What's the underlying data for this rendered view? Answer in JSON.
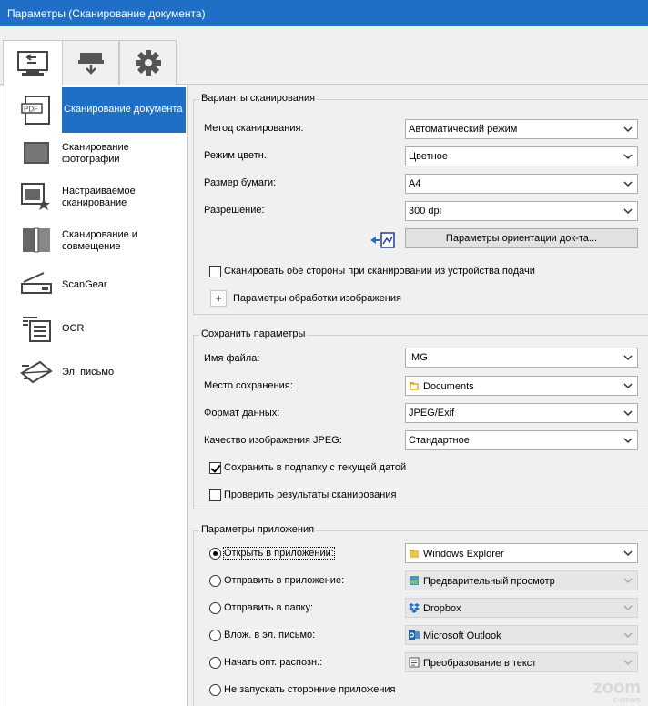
{
  "window": {
    "title": "Параметры (Сканирование документа)"
  },
  "tabs": [
    {
      "icon": "scan-from-computer-icon",
      "active": true
    },
    {
      "icon": "scan-from-panel-icon",
      "active": false
    },
    {
      "icon": "gear-icon",
      "active": false
    }
  ],
  "sidebar": {
    "items": [
      {
        "label": "Сканирование документа",
        "icon": "pdf-document-icon",
        "active": true
      },
      {
        "label": "Сканирование фотографии",
        "icon": "photo-icon",
        "active": false
      },
      {
        "label": "Настраиваемое сканирование",
        "icon": "custom-scan-icon",
        "active": false
      },
      {
        "label": "Сканирование и совмещение",
        "icon": "stitch-icon",
        "active": false
      },
      {
        "label": "ScanGear",
        "icon": "scanner-icon",
        "active": false
      },
      {
        "label": "OCR",
        "icon": "ocr-icon",
        "active": false
      },
      {
        "label": "Эл. письмо",
        "icon": "email-icon",
        "active": false
      }
    ]
  },
  "scan_options": {
    "title": "Варианты сканирования",
    "method": {
      "label": "Метод сканирования:",
      "value": "Автоматический режим"
    },
    "color_mode": {
      "label": "Режим цветн.:",
      "value": "Цветное"
    },
    "paper_size": {
      "label": "Размер бумаги:",
      "value": "A4"
    },
    "resolution": {
      "label": "Разрешение:",
      "value": "300 dpi"
    },
    "orientation_button": "Параметры ориентации док-та...",
    "duplex": {
      "label": "Сканировать обе стороны при сканировании из устройства подачи",
      "checked": false
    },
    "image_processing": {
      "expand": "+",
      "label": "Параметры обработки изображения"
    }
  },
  "save_options": {
    "title": "Сохранить параметры",
    "file_name": {
      "label": "Имя файла:",
      "value": "IMG"
    },
    "save_location": {
      "label": "Место сохранения:",
      "value": "Documents"
    },
    "data_format": {
      "label": "Формат данных:",
      "value": "JPEG/Exif"
    },
    "jpeg_quality": {
      "label": "Качество изображения JPEG:",
      "value": "Стандартное"
    },
    "subfolder": {
      "label": "Сохранить в подпапку с текущей датой",
      "checked": true
    },
    "check_results": {
      "label": "Проверить результаты сканирования",
      "checked": false
    }
  },
  "app_options": {
    "title": "Параметры приложения",
    "items": [
      {
        "label": "Открыть в приложении:",
        "value": "Windows Explorer",
        "selected": true,
        "enabled": true
      },
      {
        "label": "Отправить в приложение:",
        "value": "Предварительный просмотр",
        "selected": false,
        "enabled": false
      },
      {
        "label": "Отправить в папку:",
        "value": "Dropbox",
        "selected": false,
        "enabled": false
      },
      {
        "label": "Влож. в эл. письмо:",
        "value": "Microsoft Outlook",
        "selected": false,
        "enabled": false
      },
      {
        "label": "Начать опт. распозн.:",
        "value": "Преобразование в текст",
        "selected": false,
        "enabled": false
      },
      {
        "label": "Не запускать сторонние приложения",
        "selected": false
      }
    ]
  },
  "watermark": {
    "main": "zoom",
    "sub": "c-news"
  }
}
